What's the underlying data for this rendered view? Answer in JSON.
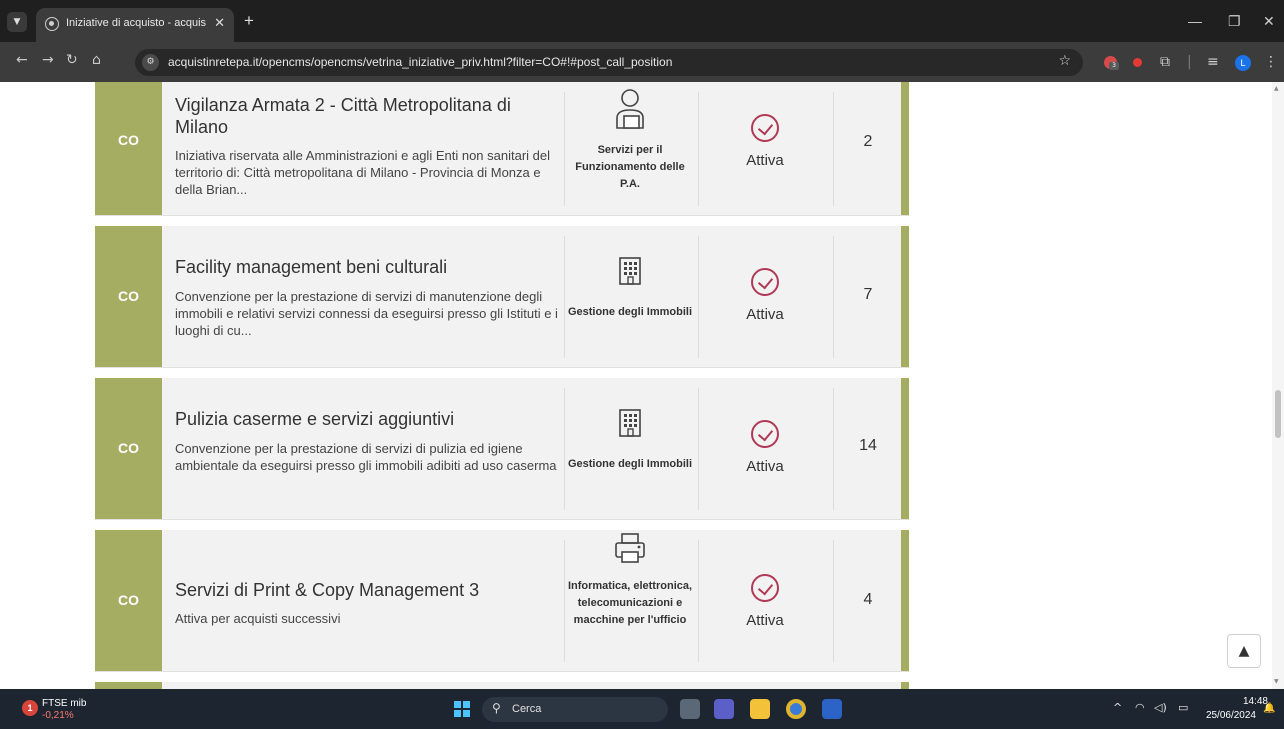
{
  "browser": {
    "tab_title": "Iniziative di acquisto - acquistin",
    "new_tab": "+",
    "url": "acquistinretepa.it/opencms/opencms/vetrina_iniziative_priv.html?filter=CO#!#post_call_position",
    "profile_initial": "L",
    "extension_badge": "3"
  },
  "cards": [
    {
      "tag": "CO",
      "title": "Vigilanza Armata 2 - Città Metropolitana di Milano",
      "description": "Iniziativa riservata alle Amministrazioni e agli Enti non sanitari del territorio di: Città metropolitana di Milano - Provincia di Monza e della Brian...",
      "category": "Servizi per il Funzionamento delle P.A.",
      "category_icon": "person-office-icon",
      "status": "Attiva",
      "count": "2"
    },
    {
      "tag": "CO",
      "title": "Facility management beni culturali",
      "description": "Convenzione per la prestazione di servizi di manutenzione degli immobili e relativi servizi connessi da eseguirsi presso gli Istituti e i luoghi di cu...",
      "category": "Gestione degli Immobili",
      "category_icon": "building-icon",
      "status": "Attiva",
      "count": "7"
    },
    {
      "tag": "CO",
      "title": "Pulizia caserme e servizi aggiuntivi",
      "description": "Convenzione per la prestazione di servizi di pulizia ed igiene ambientale da eseguirsi presso gli immobili adibiti ad uso caserma",
      "category": "Gestione degli Immobili",
      "category_icon": "building-icon",
      "status": "Attiva",
      "count": "14"
    },
    {
      "tag": "CO",
      "title": "Servizi di Print & Copy Management 3",
      "description": "Attiva per acquisti successivi",
      "category": "Informatica, elettronica, telecomunicazioni e macchine per l'ufficio",
      "category_icon": "printer-icon",
      "status": "Attiva",
      "count": "4"
    }
  ],
  "taskbar": {
    "ftse_name": "FTSE mib",
    "ftse_value": "-0,21%",
    "ftse_badge": "1",
    "search_placeholder": "Cerca",
    "time": "14:48",
    "date": "25/06/2024"
  },
  "colors": {
    "tag_green": "#a5ad63",
    "status_red": "#b03a55",
    "card_bg": "#f2f2f2"
  }
}
